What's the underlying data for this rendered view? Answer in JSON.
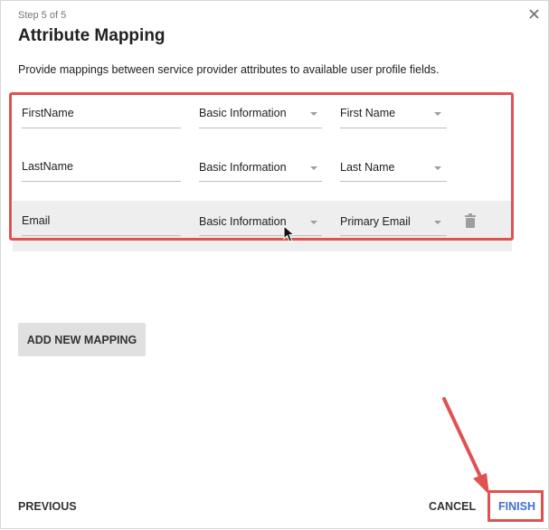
{
  "dialog": {
    "step_label": "Step 5 of 5",
    "title": "Attribute Mapping",
    "description": "Provide mappings between service provider attributes to available user profile fields."
  },
  "mappings": [
    {
      "attribute": "FirstName",
      "category": "Basic Information",
      "field": "First Name"
    },
    {
      "attribute": "LastName",
      "category": "Basic Information",
      "field": "Last Name"
    },
    {
      "attribute": "Email",
      "category": "Basic Information",
      "field": "Primary Email"
    }
  ],
  "buttons": {
    "add_mapping": "ADD NEW MAPPING",
    "previous": "PREVIOUS",
    "cancel": "CANCEL",
    "finish": "FINISH"
  },
  "icons": {
    "close": "close-icon",
    "delete": "trash-icon",
    "dropdown": "chevron-down-icon",
    "cursor": "mouse-pointer-icon"
  },
  "colors": {
    "highlight_border": "#e05252",
    "finish_text": "#3f6fd8",
    "row_hover": "#eeeeee",
    "button_bg": "#e0e0e0"
  }
}
